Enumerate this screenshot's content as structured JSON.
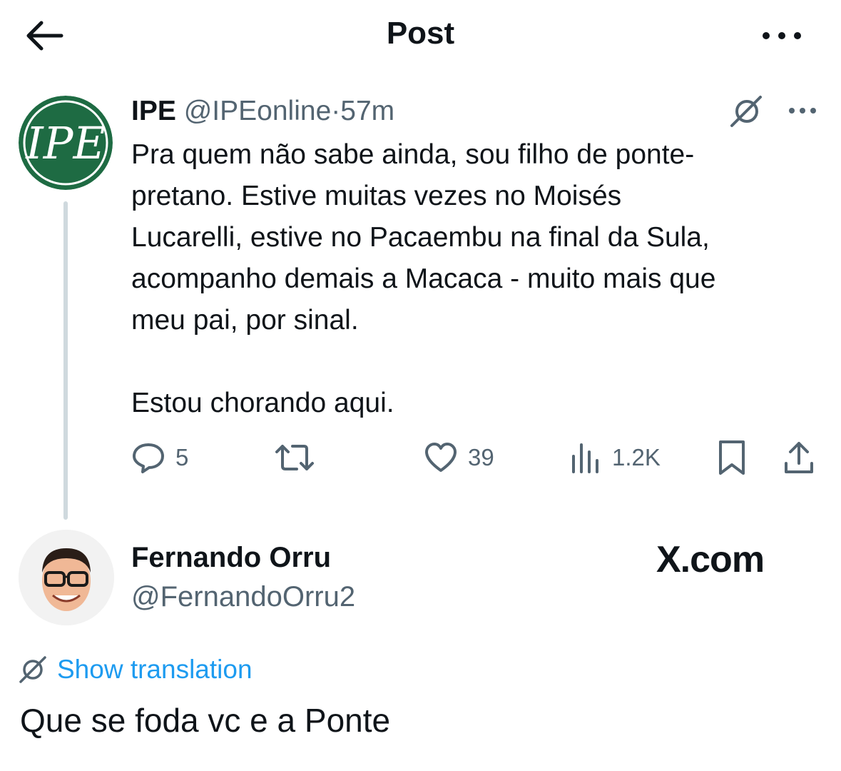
{
  "header": {
    "title": "Post",
    "back_icon": "arrow-left-icon",
    "more_icon": "more-horizontal-icon"
  },
  "post": {
    "avatar": {
      "logo_text": "IPE",
      "bg_color": "#1e6b43"
    },
    "author_name": "IPE",
    "author_handle": "@IPEonline",
    "separator": "·",
    "time": "57m",
    "text": "Pra quem não sabe ainda, sou filho de ponte-\npretano. Estive muitas vezes no Moisés\nLucarelli, estive no Pacaembu na final da Sula,\nacompanho demais a Macaca - muito mais que\nmeu pai, por sinal.\n\nEstou chorando aqui.",
    "actions": {
      "replies": "5",
      "reposts": "",
      "likes": "39",
      "views": "1.2K"
    }
  },
  "reply": {
    "author_name": "Fernando Orru",
    "author_handle": "@FernandoOrru2",
    "watermark": "X.com",
    "translation_label": "Show translation",
    "text": "Que se foda vc e a Ponte"
  },
  "colors": {
    "text": "#0f1419",
    "muted": "#536471",
    "link": "#1d9bf0",
    "thread": "#cfd9de"
  }
}
